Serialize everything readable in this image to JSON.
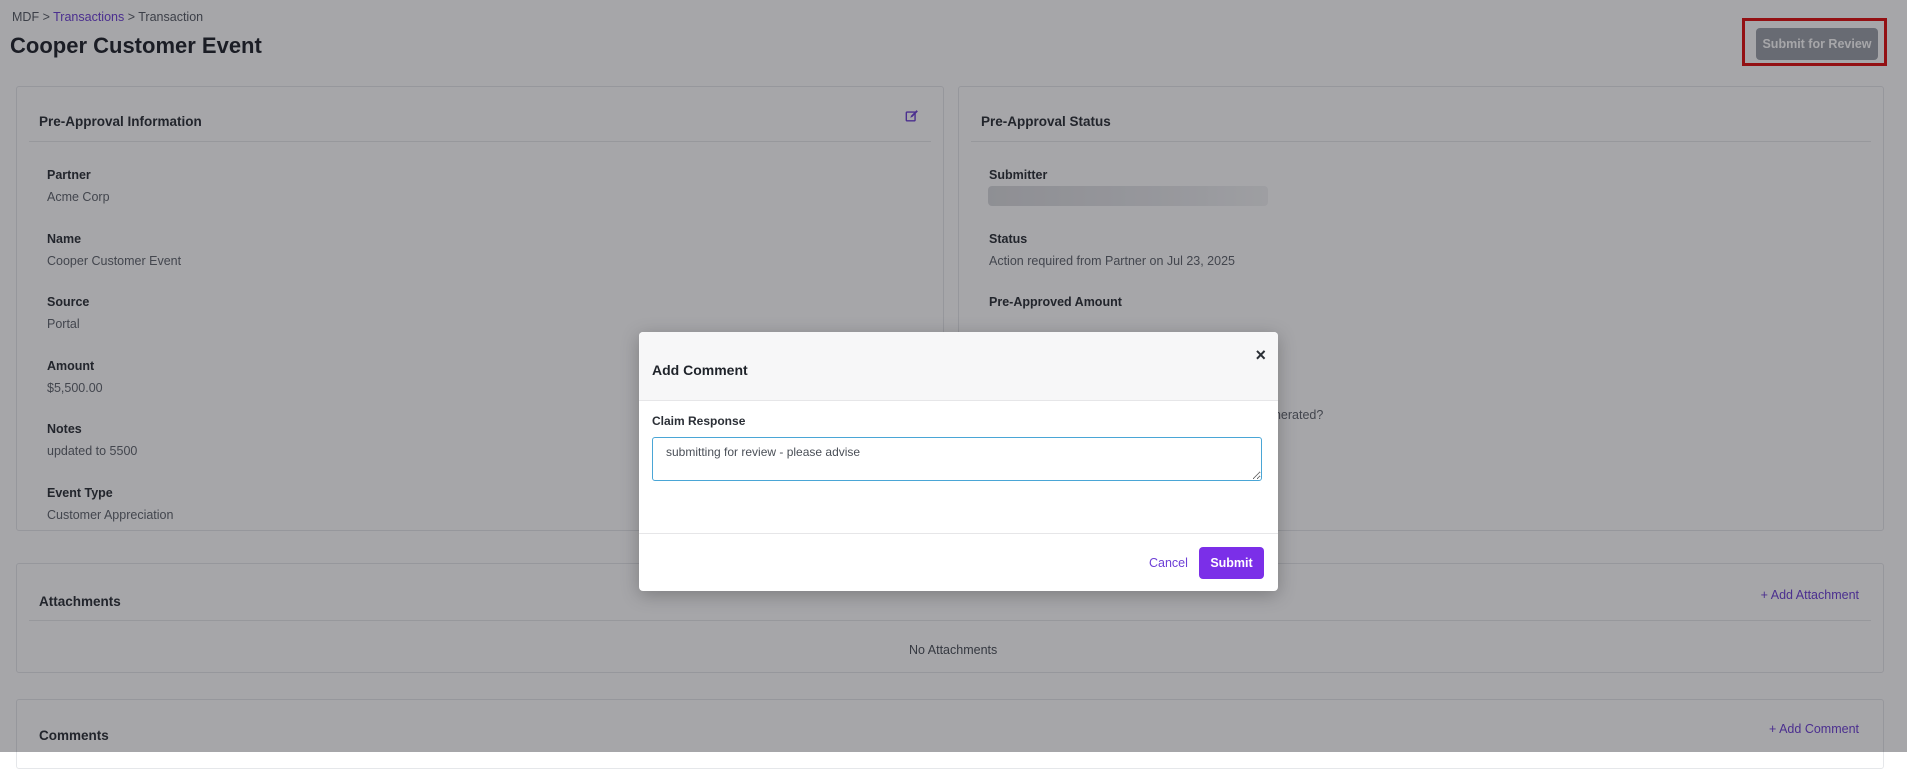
{
  "breadcrumb": {
    "root": "MDF",
    "sep1": ">",
    "link": "Transactions",
    "sep2": ">",
    "current": "Transaction"
  },
  "page": {
    "title": "Cooper Customer Event",
    "submit_review_label": "Submit for Review"
  },
  "pre_approval_info": {
    "header": "Pre-Approval Information",
    "fields": [
      {
        "label": "Partner",
        "value": "Acme Corp"
      },
      {
        "label": "Name",
        "value": "Cooper Customer Event"
      },
      {
        "label": "Source",
        "value": "Portal"
      },
      {
        "label": "Amount",
        "value": "$5,500.00"
      },
      {
        "label": "Notes",
        "value": "updated to 5500"
      },
      {
        "label": "Event Type",
        "value": "Customer Appreciation"
      }
    ]
  },
  "pre_approval_status": {
    "header": "Pre-Approval Status",
    "submitter_label": "Submitter",
    "status_label": "Status",
    "status_value": "Action required from Partner on Jul 23, 2025",
    "amount_label": "Pre-Approved Amount",
    "partial_question": "enerated?"
  },
  "attachments": {
    "header": "Attachments",
    "add_label": "+ Add Attachment",
    "empty": "No Attachments"
  },
  "comments": {
    "header": "Comments",
    "add_label": "+ Add Comment"
  },
  "modal": {
    "title": "Add Comment",
    "close_glyph": "×",
    "field_label": "Claim Response",
    "textarea_value": "submitting for review - please advise",
    "cancel_label": "Cancel",
    "submit_label": "Submit"
  },
  "colors": {
    "accent": "#7b2fe8",
    "link": "#6d3fd6",
    "highlight": "#e10d0d"
  },
  "icons": {
    "edit": "edit-square-icon",
    "close": "close-icon"
  }
}
